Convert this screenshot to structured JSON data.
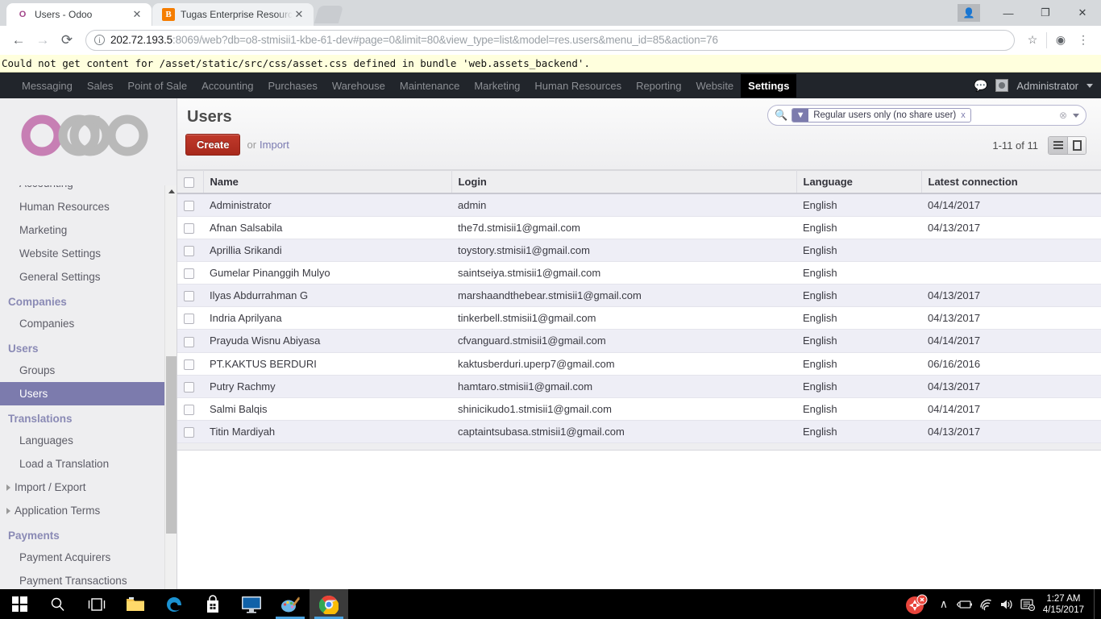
{
  "browser": {
    "tabs": [
      {
        "title": "Users - Odoo",
        "favicon": "odoo-icon",
        "active": true,
        "close": "✕"
      },
      {
        "title": "Tugas Enterprise Resourc",
        "favicon": "blogger-icon",
        "active": false,
        "close": "✕"
      }
    ],
    "url_host": "202.72.193.5",
    "url_rest": ":8069/web?db=o8-stmisii1-kbe-61-dev#page=0&limit=80&view_type=list&model=res.users&menu_id=85&action=76",
    "nav": {
      "back": "←",
      "forward": "→",
      "reload": "⟳"
    },
    "actions": {
      "bookmark": "☆",
      "extension": "extension-icon",
      "menu": "⋮",
      "profile": "profile-icon"
    },
    "window": {
      "minimize": "—",
      "maximize": "❐",
      "close": "✕"
    }
  },
  "error_strip": {
    "message": "Could not get content for /asset/static/src/css/asset.css defined in bundle 'web.assets_backend'."
  },
  "odoo": {
    "topmenu": [
      {
        "label": "Messaging",
        "active": false
      },
      {
        "label": "Sales",
        "active": false
      },
      {
        "label": "Point of Sale",
        "active": false
      },
      {
        "label": "Accounting",
        "active": false
      },
      {
        "label": "Purchases",
        "active": false
      },
      {
        "label": "Warehouse",
        "active": false
      },
      {
        "label": "Maintenance",
        "active": false
      },
      {
        "label": "Marketing",
        "active": false
      },
      {
        "label": "Human Resources",
        "active": false
      },
      {
        "label": "Reporting",
        "active": false
      },
      {
        "label": "Website",
        "active": false
      },
      {
        "label": "Settings",
        "active": true
      }
    ],
    "user": {
      "name": "Administrator"
    },
    "logo_text": "odoo",
    "sidebar": [
      {
        "type": "item",
        "label": "Accounting",
        "selected": false,
        "clipped": true
      },
      {
        "type": "item",
        "label": "Human Resources",
        "selected": false
      },
      {
        "type": "item",
        "label": "Marketing",
        "selected": false
      },
      {
        "type": "item",
        "label": "Website Settings",
        "selected": false
      },
      {
        "type": "item",
        "label": "General Settings",
        "selected": false
      },
      {
        "type": "section",
        "label": "Companies"
      },
      {
        "type": "item",
        "label": "Companies",
        "selected": false
      },
      {
        "type": "section",
        "label": "Users"
      },
      {
        "type": "item",
        "label": "Groups",
        "selected": false
      },
      {
        "type": "item",
        "label": "Users",
        "selected": true
      },
      {
        "type": "section",
        "label": "Translations"
      },
      {
        "type": "item",
        "label": "Languages",
        "selected": false
      },
      {
        "type": "item",
        "label": "Load a Translation",
        "selected": false
      },
      {
        "type": "caret",
        "label": "Import / Export",
        "selected": false
      },
      {
        "type": "caret",
        "label": "Application Terms",
        "selected": false
      },
      {
        "type": "section",
        "label": "Payments"
      },
      {
        "type": "item",
        "label": "Payment Acquirers",
        "selected": false
      },
      {
        "type": "item",
        "label": "Payment Transactions",
        "selected": false
      }
    ],
    "control_panel": {
      "title": "Users",
      "create_label": "Create",
      "or_label": "or",
      "import_label": "Import",
      "pager": "1-11 of 11",
      "search": {
        "facet_label": "Regular users only (no share user)",
        "facet_remove": "x",
        "magnifier": "search-icon",
        "filter_icon": "filter-icon",
        "clear_icon": "⊗",
        "dropdown_icon": "chevron-down-icon"
      },
      "views": {
        "list": "list-view-icon",
        "form": "form-view-icon"
      }
    },
    "table": {
      "columns": [
        "Name",
        "Login",
        "Language",
        "Latest connection"
      ],
      "rows": [
        {
          "name": "Administrator",
          "login": "admin",
          "language": "English",
          "latest": "04/14/2017"
        },
        {
          "name": "Afnan Salsabila",
          "login": "the7d.stmisii1@gmail.com",
          "language": "English",
          "latest": "04/13/2017"
        },
        {
          "name": "Aprillia Srikandi",
          "login": "toystory.stmisii1@gmail.com",
          "language": "English",
          "latest": ""
        },
        {
          "name": "Gumelar Pinanggih Mulyo",
          "login": "saintseiya.stmisii1@gmail.com",
          "language": "English",
          "latest": ""
        },
        {
          "name": "Ilyas Abdurrahman G",
          "login": "marshaandthebear.stmisii1@gmail.com",
          "language": "English",
          "latest": "04/13/2017"
        },
        {
          "name": "Indria Aprilyana",
          "login": "tinkerbell.stmisii1@gmail.com",
          "language": "English",
          "latest": "04/13/2017"
        },
        {
          "name": "Prayuda Wisnu Abiyasa",
          "login": "cfvanguard.stmisii1@gmail.com",
          "language": "English",
          "latest": "04/14/2017"
        },
        {
          "name": "PT.KAKTUS BERDURI",
          "login": "kaktusberduri.uperp7@gmail.com",
          "language": "English",
          "latest": "06/16/2016"
        },
        {
          "name": "Putry Rachmy",
          "login": "hamtaro.stmisii1@gmail.com",
          "language": "English",
          "latest": "04/13/2017"
        },
        {
          "name": "Salmi Balqis",
          "login": "shinicikudo1.stmisii1@gmail.com",
          "language": "English",
          "latest": "04/14/2017"
        },
        {
          "name": "Titin Mardiyah",
          "login": "captaintsubasa.stmisii1@gmail.com",
          "language": "English",
          "latest": "04/13/2017"
        }
      ]
    }
  },
  "taskbar": {
    "items": [
      {
        "name": "start-button",
        "icon": "windows-logo-icon"
      },
      {
        "name": "search-taskbar",
        "icon": "search-icon"
      },
      {
        "name": "task-view",
        "icon": "task-view-icon"
      },
      {
        "name": "file-explorer",
        "icon": "folder-icon"
      },
      {
        "name": "edge-browser",
        "icon": "edge-icon"
      },
      {
        "name": "microsoft-store",
        "icon": "store-icon"
      },
      {
        "name": "remote-desktop",
        "icon": "monitor-icon"
      },
      {
        "name": "paint",
        "icon": "paint-icon"
      },
      {
        "name": "chrome-browser",
        "icon": "chrome-icon"
      }
    ],
    "tray": {
      "antivirus": "antivirus-icon",
      "expand": "∧",
      "battery": "battery-icon",
      "wifi": "wifi-icon",
      "volume": "volume-icon",
      "action_center": "action-center-icon"
    },
    "clock": {
      "time": "1:27 AM",
      "date": "4/15/2017"
    }
  },
  "colors": {
    "odoo_purple": "#7c7bad",
    "odoo_logo_pink": "#c77fb4",
    "create_red": "#a8291c",
    "navbar_dark": "#21252b",
    "row_odd": "#eeeef6"
  }
}
